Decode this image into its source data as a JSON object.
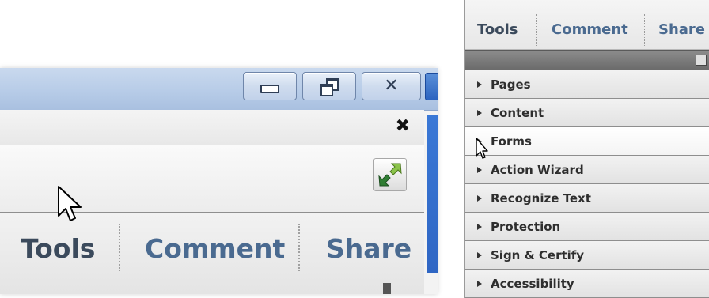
{
  "window_controls": {
    "minimize": "minimize",
    "restore": "restore",
    "close": "close"
  },
  "left_zoom": {
    "close_x": "✖",
    "tabs": [
      {
        "label": "Tools",
        "active": true
      },
      {
        "label": "Comment",
        "active": false
      },
      {
        "label": "Share",
        "active": false
      }
    ]
  },
  "right_panel": {
    "tabs": [
      {
        "label": "Tools",
        "active": true
      },
      {
        "label": "Comment",
        "active": false
      },
      {
        "label": "Share",
        "active": false
      }
    ],
    "items": [
      {
        "label": "Pages"
      },
      {
        "label": "Content"
      },
      {
        "label": "Forms",
        "hover": true
      },
      {
        "label": "Action Wizard"
      },
      {
        "label": "Recognize Text"
      },
      {
        "label": "Protection"
      },
      {
        "label": "Sign & Certify"
      },
      {
        "label": "Accessibility"
      }
    ]
  },
  "colors": {
    "tab_active": "#3b4a5c",
    "tab_inactive": "#4a6a90",
    "titlebar": "#b6cbe7"
  }
}
